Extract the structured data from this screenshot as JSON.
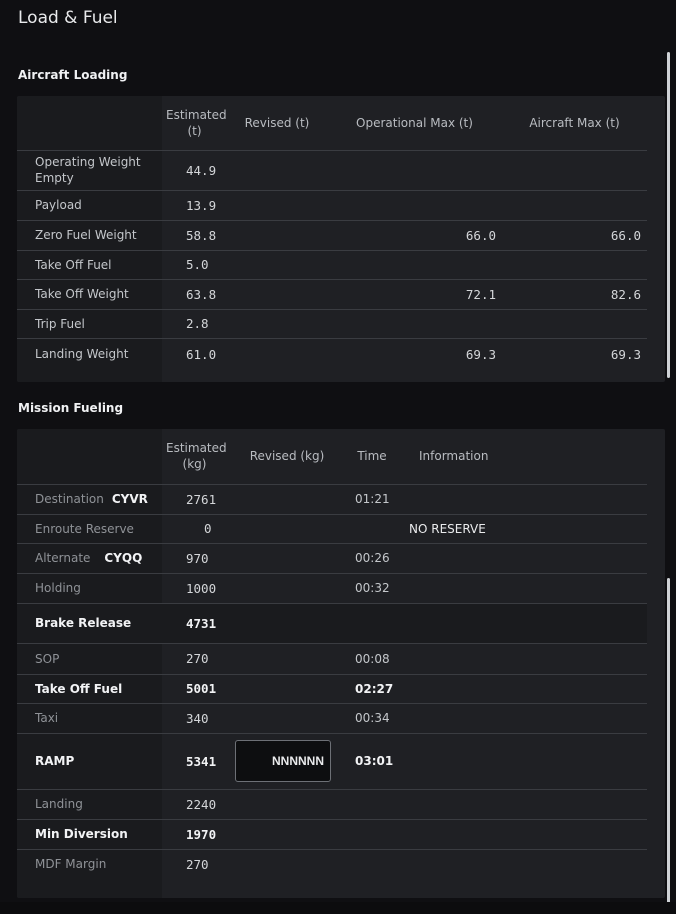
{
  "page": {
    "title": "Load & Fuel"
  },
  "loading": {
    "title": "Aircraft Loading",
    "columns": [
      "Estimated (t)",
      "Revised (t)",
      "Operational Max (t)",
      "Aircraft Max (t)"
    ],
    "rows": [
      {
        "label": "Operating Weight Empty",
        "estimated": "44.9",
        "op_max": "",
        "ac_max": ""
      },
      {
        "label": "Payload",
        "estimated": "13.9",
        "op_max": "",
        "ac_max": ""
      },
      {
        "label": "Zero Fuel Weight",
        "estimated": "58.8",
        "op_max": "66.0",
        "ac_max": "66.0"
      },
      {
        "label": "Take Off Fuel",
        "estimated": "5.0",
        "op_max": "",
        "ac_max": ""
      },
      {
        "label": "Take Off Weight",
        "estimated": "63.8",
        "op_max": "72.1",
        "ac_max": "82.6"
      },
      {
        "label": "Trip Fuel",
        "estimated": "2.8",
        "op_max": "",
        "ac_max": ""
      },
      {
        "label": "Landing Weight",
        "estimated": "61.0",
        "op_max": "69.3",
        "ac_max": "69.3"
      }
    ]
  },
  "fueling": {
    "title": "Mission Fueling",
    "columns": [
      "Estimated (kg)",
      "Revised (kg)",
      "Time",
      "Information"
    ],
    "rows": [
      {
        "label": "Destination",
        "code": "CYVR",
        "estimated": "2761",
        "time": "01:21",
        "info": ""
      },
      {
        "label": "Enroute Reserve",
        "code": "",
        "estimated": "0",
        "time": "",
        "info": "NO RESERVE"
      },
      {
        "label": "Alternate",
        "code": "CYQQ",
        "estimated": "970",
        "time": "00:26",
        "info": ""
      },
      {
        "label": "Holding",
        "code": "",
        "estimated": "1000",
        "time": "00:32",
        "info": ""
      },
      {
        "label": "Brake Release",
        "code": "",
        "estimated": "4731",
        "time": "",
        "info": ""
      },
      {
        "label": "SOP",
        "code": "",
        "estimated": "270",
        "time": "00:08",
        "info": ""
      },
      {
        "label": "Take Off Fuel",
        "code": "",
        "estimated": "5001",
        "time": "02:27",
        "info": ""
      },
      {
        "label": "Taxi",
        "code": "",
        "estimated": "340",
        "time": "00:34",
        "info": ""
      },
      {
        "label": "RAMP",
        "code": "",
        "estimated": "5341",
        "revised_value": "NNNNNN",
        "time": "03:01",
        "info": ""
      },
      {
        "label": "Landing",
        "code": "",
        "estimated": "2240",
        "time": "",
        "info": ""
      },
      {
        "label": "Min Diversion",
        "code": "",
        "estimated": "1970",
        "time": "",
        "info": ""
      },
      {
        "label": "MDF Margin",
        "code": "",
        "estimated": "270",
        "time": "",
        "info": ""
      }
    ]
  }
}
